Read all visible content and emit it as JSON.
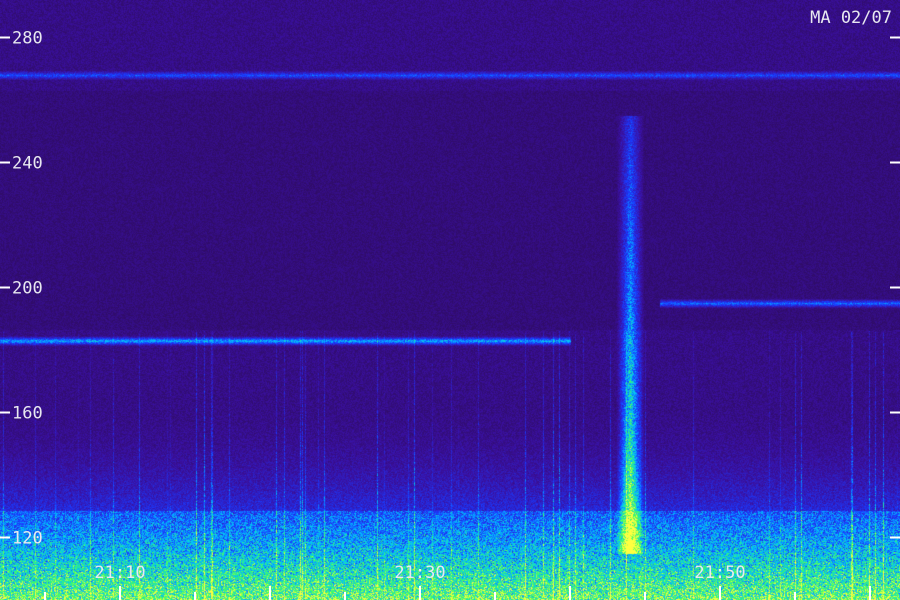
{
  "header": {
    "station_date": "MA 02/07"
  },
  "chart_data": {
    "type": "heatmap",
    "title": "",
    "xlabel": "",
    "ylabel": "",
    "y_ticks": [
      "120",
      "160",
      "200",
      "240",
      "280"
    ],
    "y_tick_values": [
      120,
      160,
      200,
      240,
      280
    ],
    "ylim": [
      100,
      292
    ],
    "x_ticks": [
      "21:10",
      "21:30",
      "21:50"
    ],
    "x_tick_values_min": [
      10,
      30,
      50
    ],
    "xlim_min": [
      2,
      62
    ],
    "colormap": [
      "#2a0a4a",
      "#3a10a0",
      "#1a3aff",
      "#00c0ff",
      "#40ff60",
      "#ffff40"
    ],
    "bands": [
      {
        "freq": 183,
        "intensity": 0.55,
        "x_start_min": 2,
        "x_end_min": 40
      },
      {
        "freq": 195,
        "intensity": 0.45,
        "x_start_min": 46,
        "x_end_min": 62
      },
      {
        "freq": 268,
        "intensity": 0.35,
        "x_start_min": 2,
        "x_end_min": 62
      }
    ],
    "bursts": [
      {
        "time_min": 44,
        "freq_min": 115,
        "freq_max": 255,
        "intensity": 0.95
      }
    ],
    "grid": false,
    "legend": "none"
  }
}
